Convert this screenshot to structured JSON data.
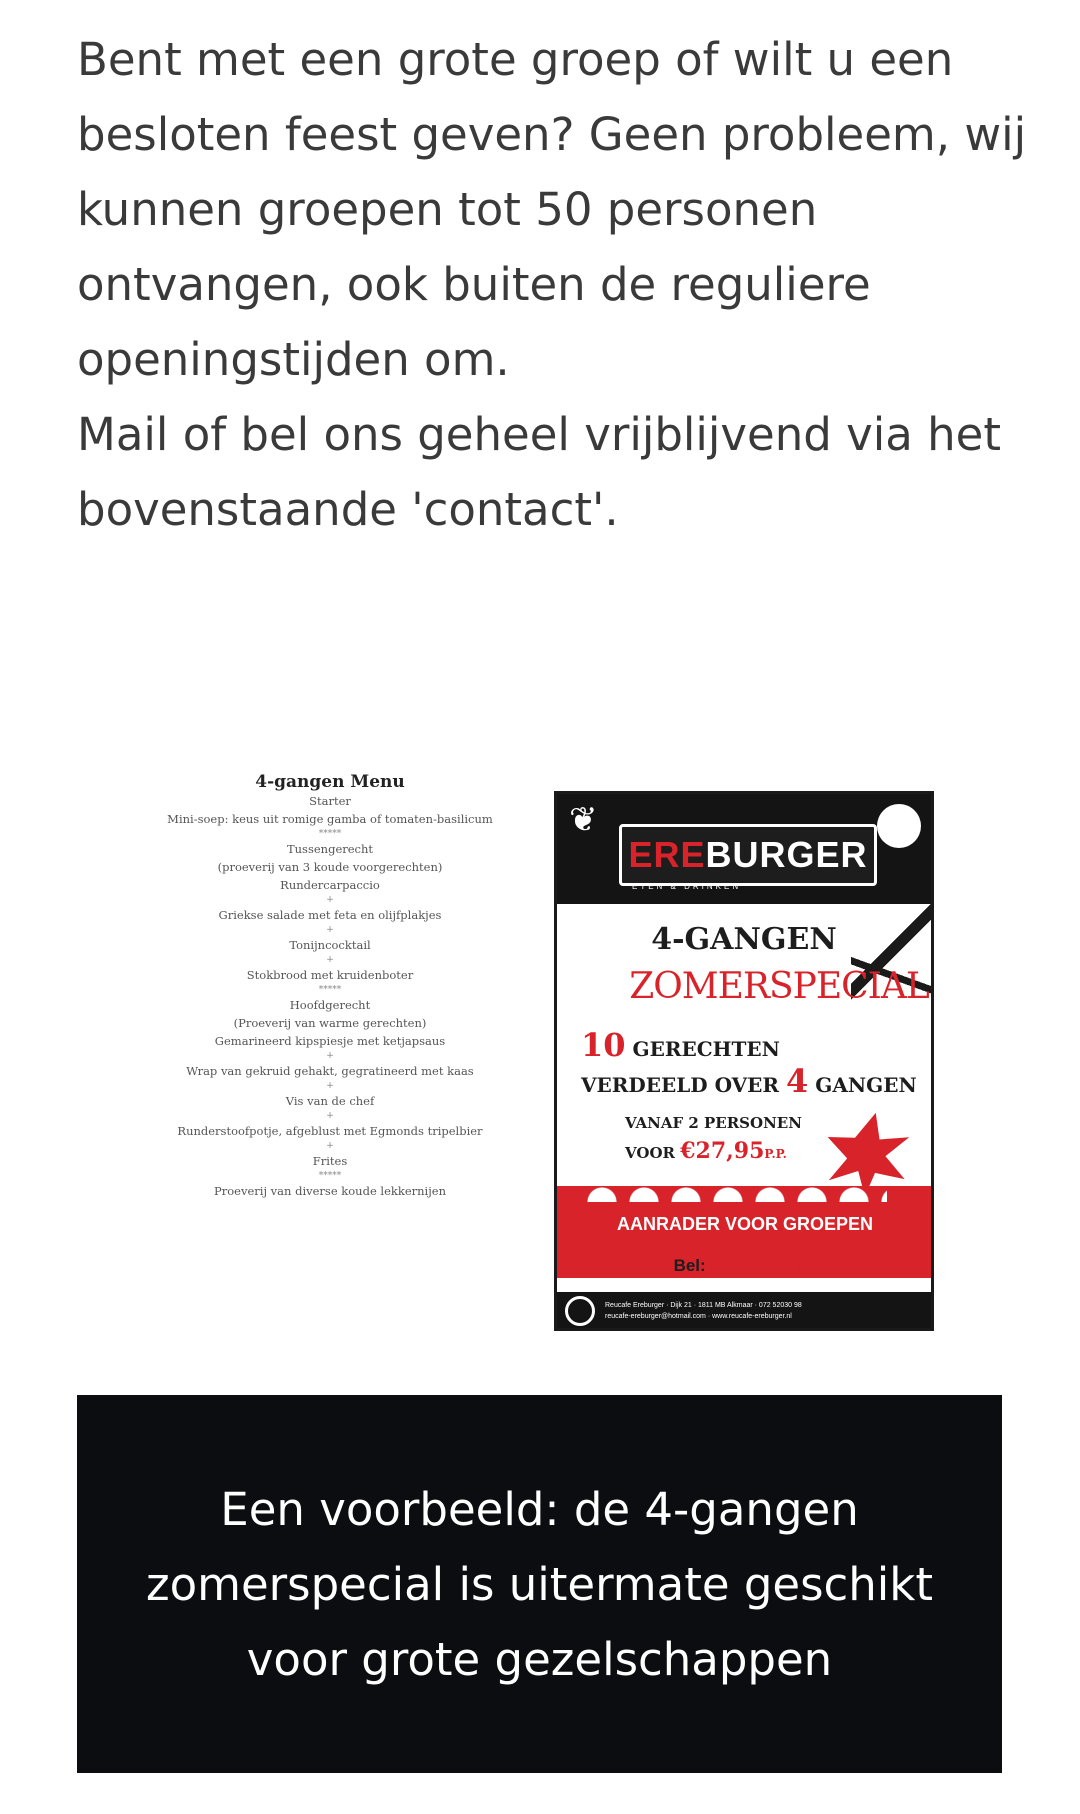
{
  "intro": {
    "paragraph1": "Bent met een grote groep of wilt u een besloten feest geven? Geen probleem, wij kunnen groepen tot 50 personen ontvangen, ook buiten de reguliere openingstijden om.",
    "paragraph2": "Mail of bel ons geheel vrijblijvend via het bovenstaande 'contact'."
  },
  "menu_card": {
    "title": "4-gangen Menu",
    "lines": [
      "Starter",
      "Mini-soep: keus uit romige gamba of tomaten-basilicum",
      "*****",
      "Tussengerecht",
      "(proeverij van 3 koude voorgerechten)",
      "Rundercarpaccio",
      "+",
      "Griekse salade met feta en olijfplakjes",
      "+",
      "Tonijncocktail",
      "+",
      "Stokbrood met kruidenboter",
      "*****",
      "Hoofdgerecht",
      "(Proeverij van warme gerechten)",
      "Gemarineerd kipspiesje met ketjapsaus",
      "+",
      "Wrap van gekruid gehakt, gegratineerd met kaas",
      "+",
      "Vis van de chef",
      "+",
      "Runderstoofpotje, afgeblust met Egmonds tripelbier",
      "+",
      "Frites",
      "*****",
      "Proeverij van diverse koude lekkernijen"
    ]
  },
  "poster": {
    "logo_red": "ERE",
    "logo_white": "BURGER",
    "logo_sub": "ETEN & DRINKEN",
    "heading1": "4-GANGEN",
    "heading2": "ZOMERSPECIAL",
    "line1_big": "10",
    "line1_text": "GERECHTEN",
    "line2_text": "VERDEELD OVER",
    "line2_big": "4",
    "line2_end": "GANGEN",
    "line3": "VANAF 2 PERSONEN",
    "line4_prefix": "VOOR",
    "price": "€27,95",
    "price_suffix": "P.P.",
    "band_text": "AANRADER VOOR GROEPEN",
    "bel_label": "Bel:",
    "bel_number": "072 52030 98",
    "footer_line1": "Reucafe Ereburger · Dijk 21 · 1811 MB Alkmaar · 072 52030 98",
    "footer_line2": "reucafe-ereburger@hotmail.com · www.reucafe-ereburger.nl"
  },
  "caption": {
    "text": "Een voorbeeld: de 4-gangen zomerspecial is uitermate geschikt voor grote gezelschappen"
  },
  "colors": {
    "text": "#3a3a3a",
    "accent_red": "#d8232a",
    "caption_bg": "#0b0d11"
  }
}
